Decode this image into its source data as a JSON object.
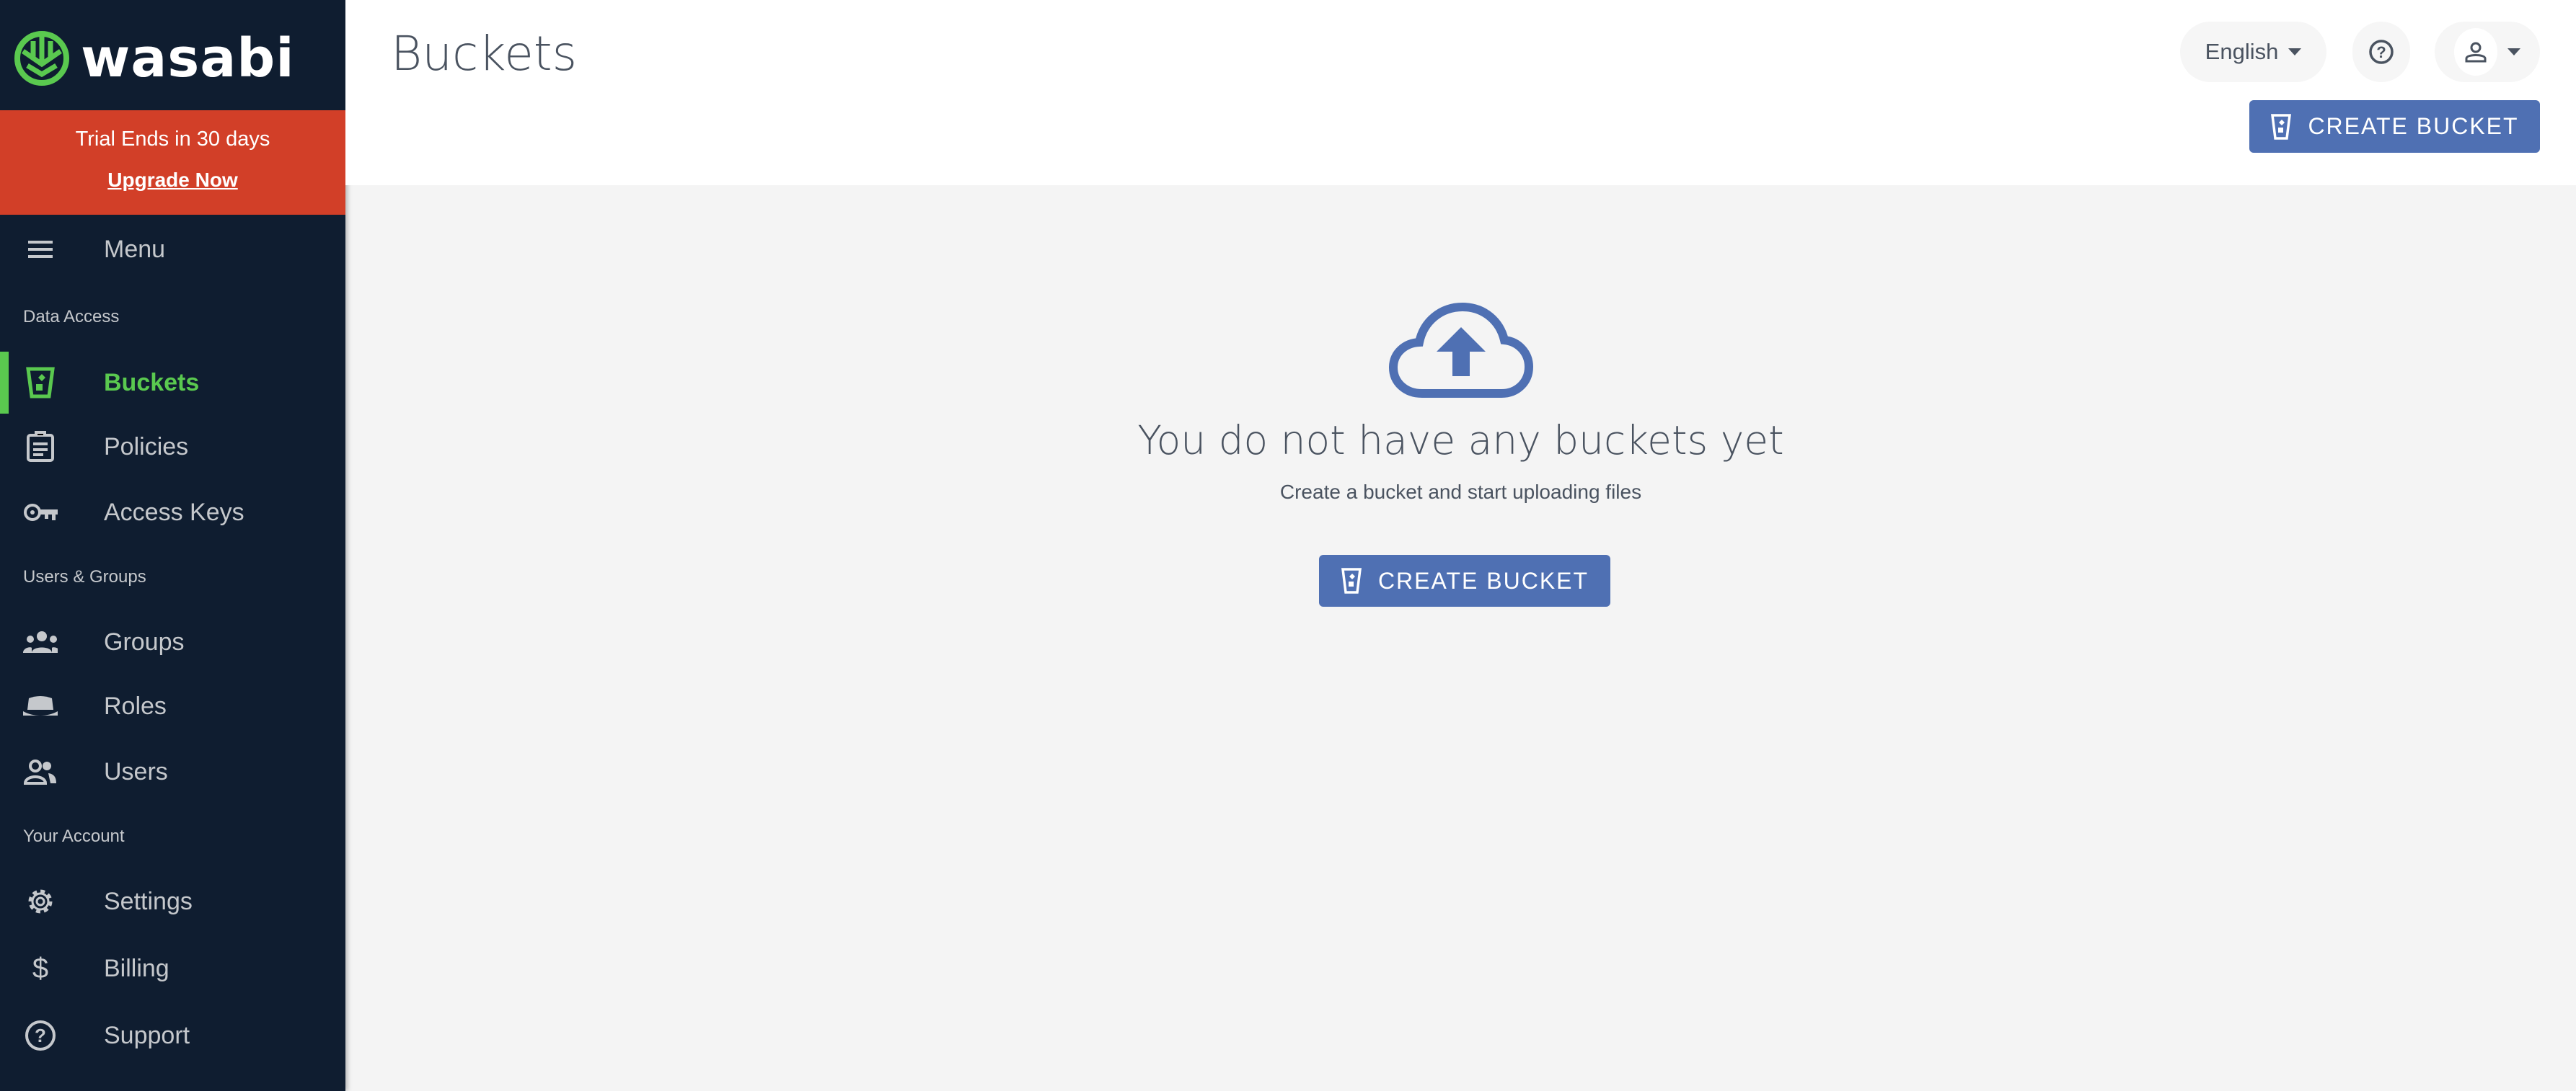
{
  "brand": {
    "name": "wasabi",
    "accent": "#5ac94f",
    "sidebar_bg": "#0f1d30",
    "primary": "#4f70b3"
  },
  "trial": {
    "text": "Trial Ends in 30 days",
    "upgrade": "Upgrade Now",
    "color": "#d23f28"
  },
  "sidebar": {
    "menu": "Menu",
    "sections": [
      "Data Access",
      "Users & Groups",
      "Your Account"
    ],
    "items": [
      {
        "label": "Buckets",
        "icon": "bucket-icon",
        "active": true
      },
      {
        "label": "Policies",
        "icon": "clipboard-icon"
      },
      {
        "label": "Access Keys",
        "icon": "key-icon"
      },
      {
        "label": "Groups",
        "icon": "groups-icon"
      },
      {
        "label": "Roles",
        "icon": "hat-icon"
      },
      {
        "label": "Users",
        "icon": "users-icon"
      },
      {
        "label": "Settings",
        "icon": "gear-icon"
      },
      {
        "label": "Billing",
        "icon": "dollar-icon"
      },
      {
        "label": "Support",
        "icon": "help-icon"
      }
    ]
  },
  "header": {
    "title": "Buckets",
    "language": "English",
    "create_label": "CREATE BUCKET"
  },
  "empty": {
    "heading": "You do not have any buckets yet",
    "subtext": "Create a bucket and start uploading files",
    "button": "CREATE BUCKET"
  }
}
